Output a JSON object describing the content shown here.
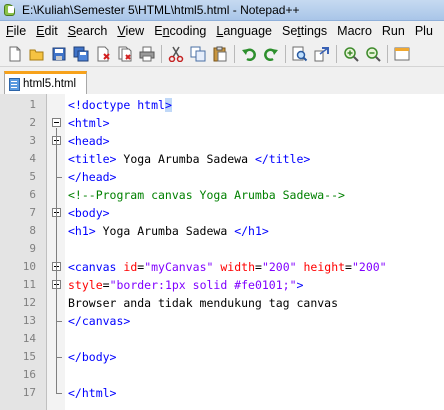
{
  "window": {
    "title": "E:\\Kuliah\\Semester 5\\HTML\\html5.html - Notepad++"
  },
  "menu": [
    {
      "pre": "",
      "key": "F",
      "post": "ile"
    },
    {
      "pre": "",
      "key": "E",
      "post": "dit"
    },
    {
      "pre": "",
      "key": "S",
      "post": "earch"
    },
    {
      "pre": "",
      "key": "V",
      "post": "iew"
    },
    {
      "pre": "E",
      "key": "n",
      "post": "coding"
    },
    {
      "pre": "",
      "key": "L",
      "post": "anguage"
    },
    {
      "pre": "Se",
      "key": "t",
      "post": "tings"
    },
    {
      "pre": "Macro",
      "key": "",
      "post": ""
    },
    {
      "pre": "Run",
      "key": "",
      "post": ""
    },
    {
      "pre": "Plu",
      "key": "",
      "post": ""
    }
  ],
  "tab": {
    "label": "html5.html"
  },
  "editor": {
    "line_numbers": [
      "1",
      "2",
      "3",
      "4",
      "5",
      "6",
      "7",
      "8",
      "9",
      "10",
      "11",
      "12",
      "13",
      "14",
      "15",
      "16",
      "17"
    ],
    "lines": [
      [
        {
          "t": "<",
          "c": "tag"
        },
        {
          "t": "!doctype html",
          "c": "tag"
        },
        {
          "t": ">",
          "c": "tag hl"
        }
      ],
      [
        {
          "t": "<html>",
          "c": "tag"
        }
      ],
      [
        {
          "t": "<head>",
          "c": "tag"
        }
      ],
      [
        {
          "t": "<title>",
          "c": "tag"
        },
        {
          "t": " Yoga Arumba Sadewa ",
          "c": "txt"
        },
        {
          "t": "</title>",
          "c": "tag"
        }
      ],
      [
        {
          "t": "</head>",
          "c": "tag"
        }
      ],
      [
        {
          "t": "<!--Program canvas Yoga Arumba Sadewa-->",
          "c": "cmt"
        }
      ],
      [
        {
          "t": "<body>",
          "c": "tag"
        }
      ],
      [
        {
          "t": "<h1>",
          "c": "tag"
        },
        {
          "t": " Yoga Arumba Sadewa ",
          "c": "txt"
        },
        {
          "t": "</h1>",
          "c": "tag"
        }
      ],
      [],
      [
        {
          "t": "<canvas ",
          "c": "tag"
        },
        {
          "t": "id",
          "c": "attr"
        },
        {
          "t": "=",
          "c": "txt"
        },
        {
          "t": "\"myCanvas\"",
          "c": "val"
        },
        {
          "t": " ",
          "c": "txt"
        },
        {
          "t": "width",
          "c": "attr"
        },
        {
          "t": "=",
          "c": "txt"
        },
        {
          "t": "\"200\"",
          "c": "val"
        },
        {
          "t": " ",
          "c": "txt"
        },
        {
          "t": "height",
          "c": "attr"
        },
        {
          "t": "=",
          "c": "txt"
        },
        {
          "t": "\"200\"",
          "c": "val"
        }
      ],
      [
        {
          "t": "style",
          "c": "attr"
        },
        {
          "t": "=",
          "c": "txt"
        },
        {
          "t": "\"border:1px solid #fe0101;\"",
          "c": "val"
        },
        {
          "t": ">",
          "c": "tag"
        }
      ],
      [
        {
          "t": "Browser anda tidak mendukung tag canvas",
          "c": "txt"
        }
      ],
      [
        {
          "t": "</canvas>",
          "c": "tag"
        }
      ],
      [],
      [
        {
          "t": "</body>",
          "c": "tag"
        }
      ],
      [],
      [
        {
          "t": "</html>",
          "c": "tag"
        }
      ]
    ]
  }
}
